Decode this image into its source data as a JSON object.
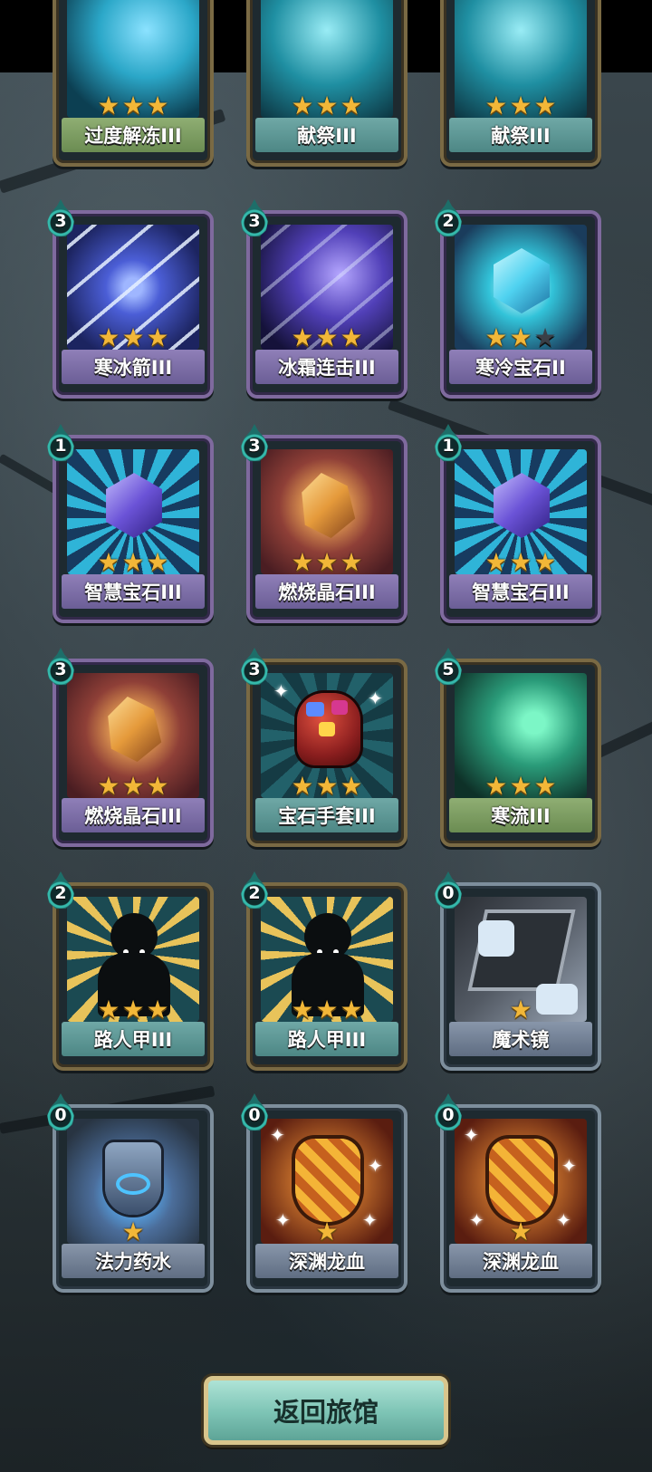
{
  "return_button": {
    "label": "返回旅馆"
  },
  "cards": [
    {
      "name": "过度解冻III",
      "cost": null,
      "stars": 3,
      "max_stars": 3,
      "art": "ice-crystal",
      "label_color": "green",
      "frame": "gold"
    },
    {
      "name": "献祭III",
      "cost": null,
      "stars": 3,
      "max_stars": 3,
      "art": "ice-storm",
      "label_color": "teal",
      "frame": "gold"
    },
    {
      "name": "献祭III",
      "cost": null,
      "stars": 3,
      "max_stars": 3,
      "art": "ice-storm",
      "label_color": "teal",
      "frame": "gold"
    },
    {
      "name": "寒冰箭III",
      "cost": "3",
      "stars": 3,
      "max_stars": 3,
      "art": "ice-arrows",
      "label_color": "purple",
      "frame": "purple"
    },
    {
      "name": "冰霜连击III",
      "cost": "3",
      "stars": 3,
      "max_stars": 3,
      "art": "frost-strike",
      "label_color": "purple",
      "frame": "purple"
    },
    {
      "name": "寒冷宝石II",
      "cost": "2",
      "stars": 2,
      "max_stars": 3,
      "art": "ice-gem",
      "label_color": "purple",
      "frame": "purple"
    },
    {
      "name": "智慧宝石III",
      "cost": "1",
      "stars": 3,
      "max_stars": 3,
      "art": "wisdom-gem",
      "label_color": "purple",
      "frame": "purple"
    },
    {
      "name": "燃烧晶石III",
      "cost": "3",
      "stars": 3,
      "max_stars": 3,
      "art": "burning-crystal",
      "label_color": "purple",
      "frame": "purple"
    },
    {
      "name": "智慧宝石III",
      "cost": "1",
      "stars": 3,
      "max_stars": 3,
      "art": "wisdom-gem",
      "label_color": "purple",
      "frame": "purple"
    },
    {
      "name": "燃烧晶石III",
      "cost": "3",
      "stars": 3,
      "max_stars": 3,
      "art": "burning-crystal",
      "label_color": "purple",
      "frame": "purple"
    },
    {
      "name": "宝石手套III",
      "cost": "3",
      "stars": 3,
      "max_stars": 3,
      "art": "gem-gauntlet",
      "label_color": "teal",
      "frame": "gold"
    },
    {
      "name": "寒流III",
      "cost": "5",
      "stars": 3,
      "max_stars": 3,
      "art": "cold-current",
      "label_color": "green",
      "frame": "gold"
    },
    {
      "name": "路人甲III",
      "cost": "2",
      "stars": 3,
      "max_stars": 3,
      "art": "passerby",
      "label_color": "teal",
      "frame": "gold"
    },
    {
      "name": "路人甲III",
      "cost": "2",
      "stars": 3,
      "max_stars": 3,
      "art": "passerby",
      "label_color": "teal",
      "frame": "gold"
    },
    {
      "name": "魔术镜",
      "cost": "0",
      "stars": 1,
      "max_stars": 1,
      "art": "magic-mirror",
      "label_color": "slate",
      "frame": "blue"
    },
    {
      "name": "法力药水",
      "cost": "0",
      "stars": 1,
      "max_stars": 1,
      "art": "mana-potion",
      "label_color": "slate",
      "frame": "blue"
    },
    {
      "name": "深渊龙血",
      "cost": "0",
      "stars": 1,
      "max_stars": 1,
      "art": "abyss-dragon-blood",
      "label_color": "slate",
      "frame": "blue"
    },
    {
      "name": "深渊龙血",
      "cost": "0",
      "stars": 1,
      "max_stars": 1,
      "art": "abyss-dragon-blood",
      "label_color": "slate",
      "frame": "blue"
    }
  ]
}
